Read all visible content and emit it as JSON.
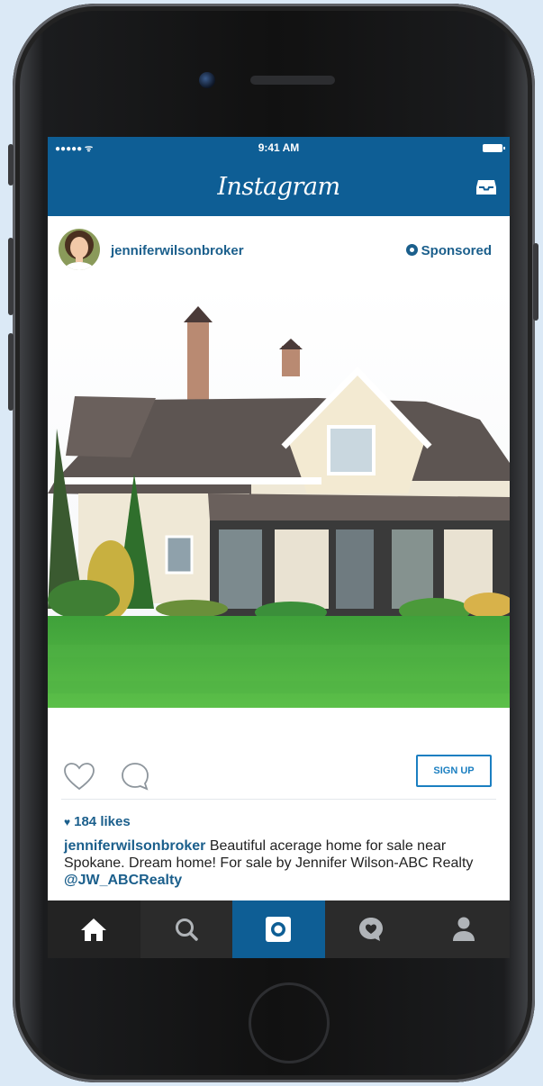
{
  "status_bar": {
    "signal": "●●●●● ᯤ",
    "time": "9:41 AM"
  },
  "app": {
    "title": "Instagram",
    "inbox_icon": "inbox-tray-icon"
  },
  "post": {
    "username": "jenniferwilsonbroker",
    "sponsored_label": "Sponsored",
    "image_alt": "house-with-lawn-photo",
    "cta_label": "SIGN UP",
    "likes": "184 likes",
    "caption": {
      "user": "jenniferwilsonbroker",
      "text": " Beautiful acerage home for sale near Spokane. Dream home! For sale by Jennifer Wilson-ABC Realty ",
      "handle": "@JW_ABCRealty"
    }
  },
  "tab_bar": {
    "tabs": [
      {
        "icon": "home-icon",
        "active": true
      },
      {
        "icon": "search-icon",
        "active": false
      },
      {
        "icon": "camera-icon",
        "active": false
      },
      {
        "icon": "activity-icon",
        "active": false
      },
      {
        "icon": "profile-icon",
        "active": false
      }
    ]
  },
  "colors": {
    "brand": "#0e5e95",
    "link": "#1b5f8c",
    "cta": "#1b7fc1",
    "tab_bar": "#2b2b2b",
    "background": "#dbe9f6"
  }
}
